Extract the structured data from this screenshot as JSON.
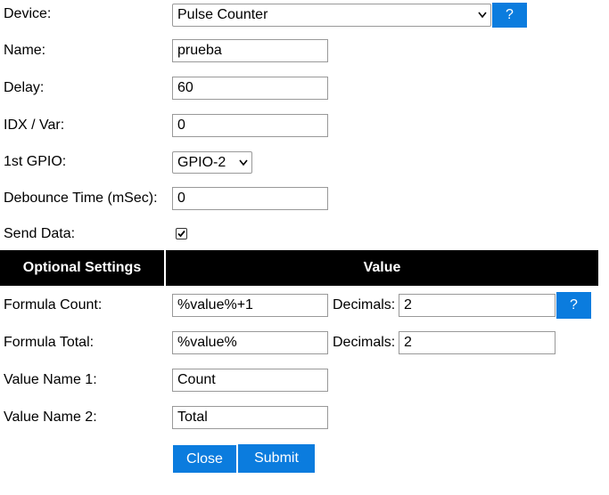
{
  "fields": {
    "device": {
      "label": "Device:",
      "value": "Pulse Counter",
      "help": "?"
    },
    "name": {
      "label": "Name:",
      "value": "prueba"
    },
    "delay": {
      "label": "Delay:",
      "value": "60"
    },
    "idx": {
      "label": "IDX / Var:",
      "value": "0"
    },
    "gpio": {
      "label": "1st GPIO:",
      "value": "GPIO-2"
    },
    "debounce": {
      "label": "Debounce Time (mSec):",
      "value": "0"
    },
    "send_data": {
      "label": "Send Data:",
      "checked": true
    }
  },
  "table_header": {
    "col1": "Optional Settings",
    "col2": "Value"
  },
  "optional": {
    "formula_count": {
      "label": "Formula Count:",
      "value": "%value%+1",
      "decimals_label": "Decimals:",
      "decimals_value": "2",
      "help": "?"
    },
    "formula_total": {
      "label": "Formula Total:",
      "value": "%value%",
      "decimals_label": "Decimals:",
      "decimals_value": "2"
    },
    "value_name_1": {
      "label": "Value Name 1:",
      "value": "Count"
    },
    "value_name_2": {
      "label": "Value Name 2:",
      "value": "Total"
    }
  },
  "buttons": {
    "close": "Close",
    "submit": "Submit"
  },
  "colors": {
    "accent": "#0b7cde",
    "header_bg": "#000000"
  }
}
